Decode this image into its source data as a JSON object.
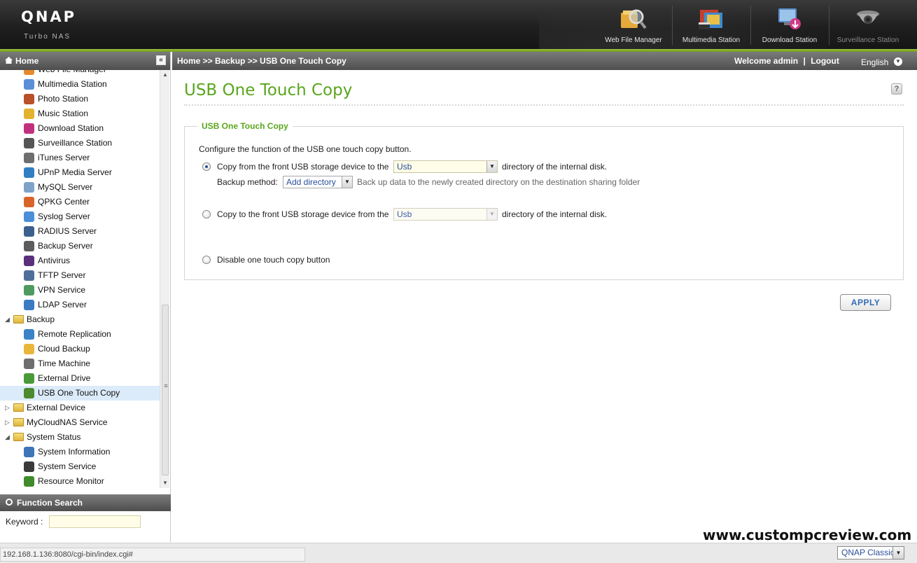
{
  "brand": {
    "logo": "QNAP",
    "subtitle": "Turbo NAS"
  },
  "top_apps": [
    {
      "label": "Web File Manager",
      "icon": "web-file-manager-icon"
    },
    {
      "label": "Multimedia Station",
      "icon": "multimedia-station-icon"
    },
    {
      "label": "Download Station",
      "icon": "download-station-icon"
    },
    {
      "label": "Surveillance Station",
      "icon": "surveillance-station-icon"
    }
  ],
  "left_panel": {
    "title": "Home",
    "tree": [
      {
        "label": "Web File Manager",
        "type": "child",
        "icon": "web-file-manager-icon",
        "color": "#e58a2a"
      },
      {
        "label": "Multimedia Station",
        "type": "child",
        "icon": "multimedia-station-icon",
        "color": "#5b8fd6"
      },
      {
        "label": "Photo Station",
        "type": "child",
        "icon": "photo-station-icon",
        "color": "#b8502a"
      },
      {
        "label": "Music Station",
        "type": "child",
        "icon": "music-station-icon",
        "color": "#e3b22e"
      },
      {
        "label": "Download Station",
        "type": "child",
        "icon": "download-station-icon",
        "color": "#c0307d"
      },
      {
        "label": "Surveillance Station",
        "type": "child",
        "icon": "surveillance-station-icon",
        "color": "#555555"
      },
      {
        "label": "iTunes Server",
        "type": "child",
        "icon": "apple-icon",
        "color": "#6e6e6e"
      },
      {
        "label": "UPnP Media Server",
        "type": "child",
        "icon": "upnp-icon",
        "color": "#2f7fc2"
      },
      {
        "label": "MySQL Server",
        "type": "child",
        "icon": "mysql-icon",
        "color": "#7fa3c8"
      },
      {
        "label": "QPKG Center",
        "type": "child",
        "icon": "qpkg-icon",
        "color": "#d9642a"
      },
      {
        "label": "Syslog Server",
        "type": "child",
        "icon": "syslog-icon",
        "color": "#4a8fd8"
      },
      {
        "label": "RADIUS Server",
        "type": "child",
        "icon": "radius-icon",
        "color": "#3d5f8e"
      },
      {
        "label": "Backup Server",
        "type": "child",
        "icon": "backup-server-icon",
        "color": "#5c5c5c"
      },
      {
        "label": "Antivirus",
        "type": "child",
        "icon": "antivirus-icon",
        "color": "#5a2f7c"
      },
      {
        "label": "TFTP Server",
        "type": "child",
        "icon": "tftp-icon",
        "color": "#4f6f9a"
      },
      {
        "label": "VPN Service",
        "type": "child",
        "icon": "vpn-icon",
        "color": "#4f9a5f"
      },
      {
        "label": "LDAP Server",
        "type": "child",
        "icon": "ldap-icon",
        "color": "#3a7bc4"
      },
      {
        "label": "Backup",
        "type": "group",
        "expanded": true
      },
      {
        "label": "Remote Replication",
        "type": "child",
        "icon": "remote-replication-icon",
        "color": "#3b82c7"
      },
      {
        "label": "Cloud Backup",
        "type": "child",
        "icon": "cloud-backup-icon",
        "color": "#e9b53a"
      },
      {
        "label": "Time Machine",
        "type": "child",
        "icon": "apple-icon",
        "color": "#6e6e6e"
      },
      {
        "label": "External Drive",
        "type": "child",
        "icon": "external-drive-icon",
        "color": "#4a9a3a"
      },
      {
        "label": "USB One Touch Copy",
        "type": "child",
        "icon": "usb-icon",
        "color": "#4b8a2e",
        "selected": true
      },
      {
        "label": "External Device",
        "type": "group",
        "expanded": false
      },
      {
        "label": "MyCloudNAS Service",
        "type": "group",
        "expanded": false
      },
      {
        "label": "System Status",
        "type": "group",
        "expanded": true
      },
      {
        "label": "System Information",
        "type": "child",
        "icon": "system-information-icon",
        "color": "#3e74b8"
      },
      {
        "label": "System Service",
        "type": "child",
        "icon": "system-service-icon",
        "color": "#3a3a3a"
      },
      {
        "label": "Resource Monitor",
        "type": "child",
        "icon": "resource-monitor-icon",
        "color": "#3f8a2a"
      }
    ],
    "function_search": {
      "title": "Function Search",
      "keyword_label": "Keyword :",
      "keyword_value": ""
    }
  },
  "header": {
    "breadcrumb": "Home >> Backup >> USB One Touch Copy",
    "welcome": "Welcome admin",
    "separator": "|",
    "logout": "Logout",
    "language": "English"
  },
  "page": {
    "title": "USB One Touch Copy",
    "section_title": "USB One Touch Copy",
    "intro": "Configure the function of the USB one touch copy button.",
    "option1": {
      "label": "Copy from the front USB storage device to the",
      "select_value": "Usb",
      "suffix": "directory of the internal disk.",
      "checked": true,
      "backup_method_label": "Backup method:",
      "backup_method_value": "Add directory",
      "backup_method_desc": "Back up data to the newly created directory on the destination sharing folder"
    },
    "option2": {
      "label": "Copy to the front USB storage device from the",
      "select_value": "Usb",
      "suffix": "directory of the internal disk.",
      "checked": false
    },
    "option3": {
      "label": "Disable one touch copy button",
      "checked": false
    },
    "apply_label": "APPLY"
  },
  "watermark": "www.custompcreview.com",
  "status_bar": {
    "url": "192.168.1.136:8080/cgi-bin/index.cgi#",
    "theme": "QNAP Classic"
  },
  "colors": {
    "accent_green": "#5aa51d",
    "link_blue": "#2f6bb3",
    "header_gray": "#5e5e5e"
  }
}
